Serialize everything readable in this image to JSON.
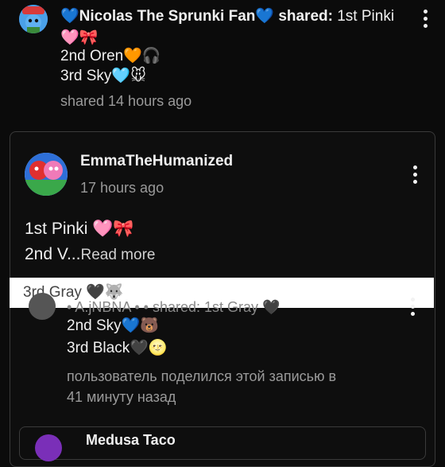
{
  "top_post": {
    "author": "💙Nicolas The Sprunki Fan💙",
    "action": "shared:",
    "line1": "1st Pinki",
    "line2": "🩷🎀",
    "line3": "2nd Oren🧡🎧",
    "line4": "3rd Sky🩵🐭",
    "timestamp": "shared 14 hours ago"
  },
  "shared_card": {
    "author": "EmmaTheHumanized",
    "timestamp": "17 hours ago",
    "body_line1": "1st Pinki 🩷🎀",
    "body_line2_start": "2nd V...",
    "read_more": "Read more"
  },
  "overlay_strip": {
    "text": "3rd Gray 🖤🐺"
  },
  "bottom_post": {
    "obscured_header": "• A.jNBNA • • shared: 1st Gray 🖤",
    "line1": "2nd Sky💙🐻",
    "line2": "3rd Black🖤🌝",
    "timestamp_line1": "пользователь поделился этой записью в",
    "timestamp_line2": "41 минуту назад"
  },
  "next_card": {
    "author": "Medusa Taco"
  },
  "colors": {
    "background": "#0b0b0b",
    "card_border": "#3a3a3a",
    "muted_text": "#9a9a9a"
  }
}
